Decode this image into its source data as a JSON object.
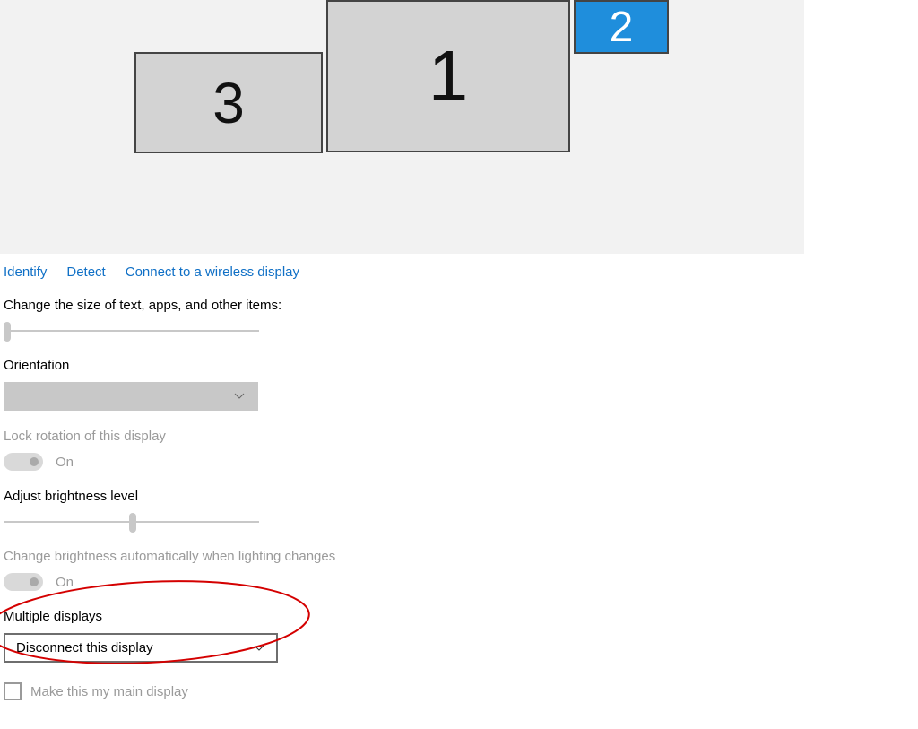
{
  "displays": {
    "monitor1": "1",
    "monitor2": "2",
    "monitor3": "3"
  },
  "links": {
    "identify": "Identify",
    "detect": "Detect",
    "wireless": "Connect to a wireless display"
  },
  "scale": {
    "label": "Change the size of text, apps, and other items:"
  },
  "orientation": {
    "label": "Orientation"
  },
  "lock_rotation": {
    "label": "Lock rotation of this display",
    "status": "On"
  },
  "brightness": {
    "label": "Adjust brightness level"
  },
  "auto_brightness": {
    "label": "Change brightness automatically when lighting changes",
    "status": "On"
  },
  "multiple_displays": {
    "label": "Multiple displays",
    "selected": "Disconnect this display"
  },
  "main_display": {
    "label": "Make this my main display"
  }
}
